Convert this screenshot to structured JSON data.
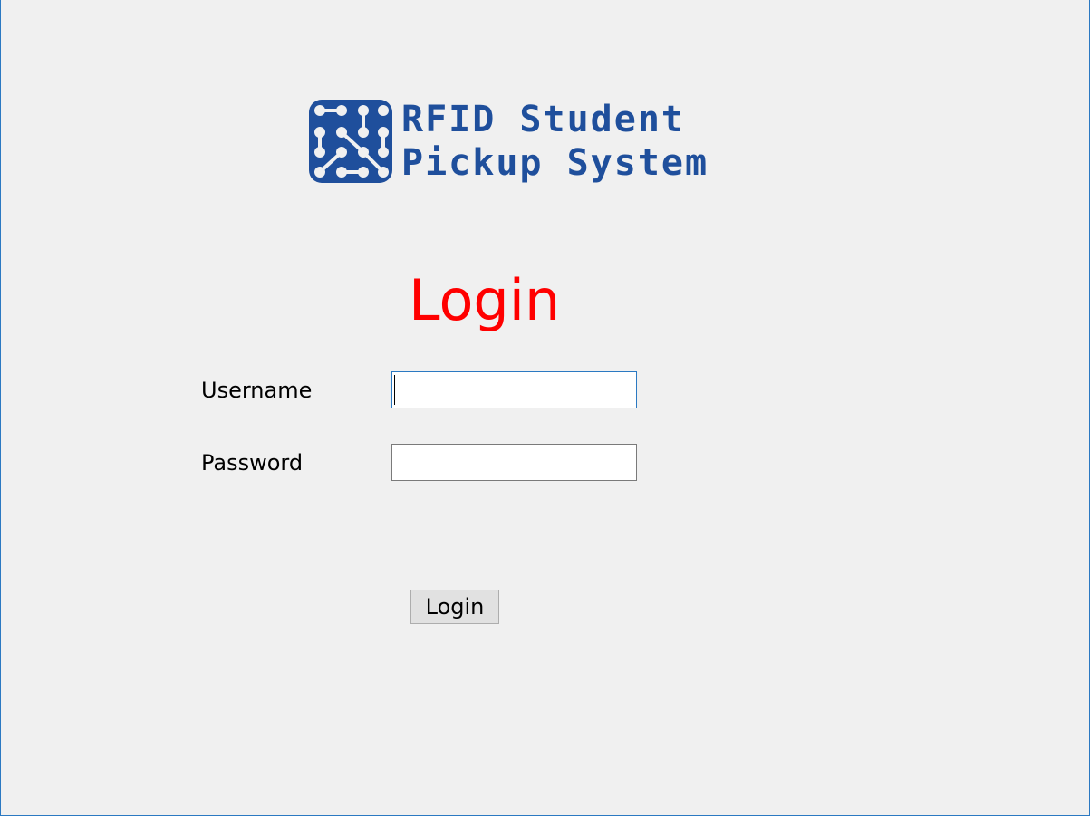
{
  "logo": {
    "line1": "RFID Student",
    "line2": "Pickup System",
    "color": "#1f4f9c"
  },
  "form": {
    "heading": "Login",
    "heading_color": "#ff0000",
    "username_label": "Username",
    "username_value": "",
    "password_label": "Password",
    "password_value": "",
    "submit_label": "Login"
  },
  "colors": {
    "background": "#f0f0f0",
    "focus_border": "#2b79c2"
  }
}
